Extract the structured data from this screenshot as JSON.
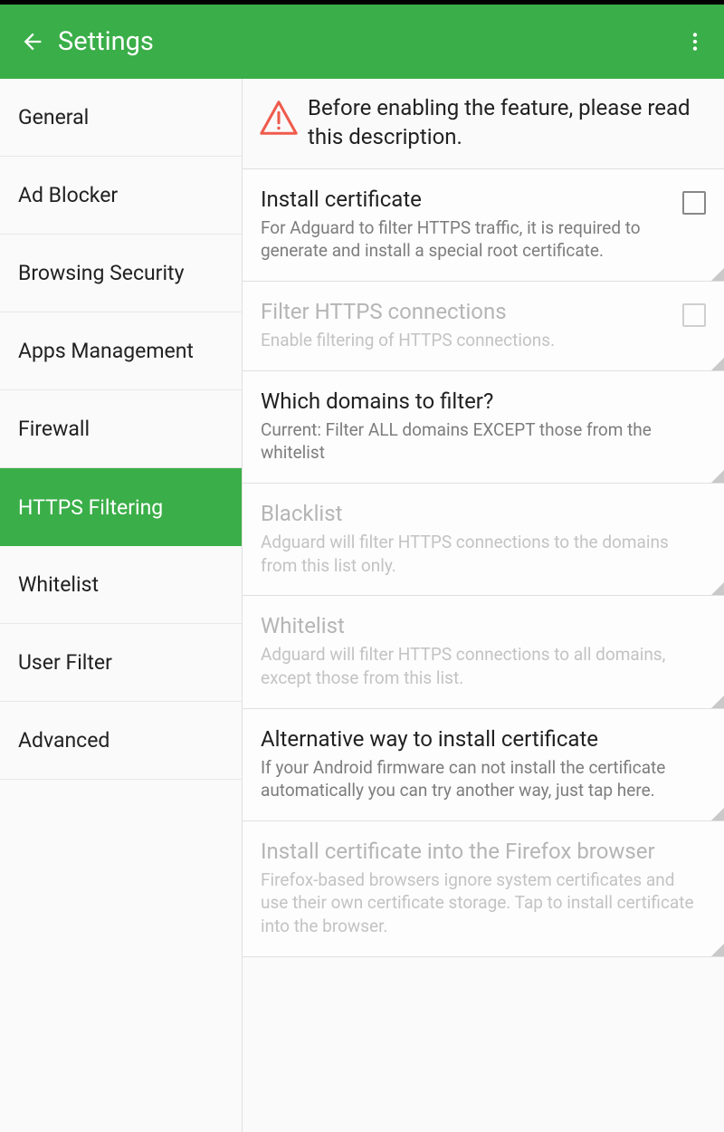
{
  "header": {
    "title": "Settings"
  },
  "sidebar": {
    "items": [
      {
        "label": "General"
      },
      {
        "label": "Ad Blocker"
      },
      {
        "label": "Browsing Security"
      },
      {
        "label": "Apps Management"
      },
      {
        "label": "Firewall"
      },
      {
        "label": "HTTPS Filtering"
      },
      {
        "label": "Whitelist"
      },
      {
        "label": "User Filter"
      },
      {
        "label": "Advanced"
      }
    ],
    "selected_index": 5
  },
  "content": {
    "warning": "Before enabling the feature, please read this description.",
    "settings": [
      {
        "title": "Install certificate",
        "desc": "For Adguard to filter HTTPS traffic, it is required to generate and install a special root certificate.",
        "checkbox": true,
        "disabled": false
      },
      {
        "title": "Filter HTTPS connections",
        "desc": "Enable filtering of HTTPS connections.",
        "checkbox": true,
        "disabled": true
      },
      {
        "title": "Which domains to filter?",
        "desc": "Current: Filter ALL domains EXCEPT those from the whitelist",
        "checkbox": false,
        "disabled": false
      },
      {
        "title": "Blacklist",
        "desc": "Adguard will filter HTTPS connections to the domains from this list only.",
        "checkbox": false,
        "disabled": true
      },
      {
        "title": "Whitelist",
        "desc": "Adguard will filter HTTPS connections to all domains, except those from this list.",
        "checkbox": false,
        "disabled": true
      },
      {
        "title": "Alternative way to install certificate",
        "desc": "If your Android firmware can not install the certificate automatically you can try another way, just tap here.",
        "checkbox": false,
        "disabled": false
      },
      {
        "title": "Install certificate into the Firefox browser",
        "desc": "Firefox-based browsers ignore system certificates and use their own certificate storage. Tap to install certificate into the browser.",
        "checkbox": false,
        "disabled": true
      }
    ]
  }
}
